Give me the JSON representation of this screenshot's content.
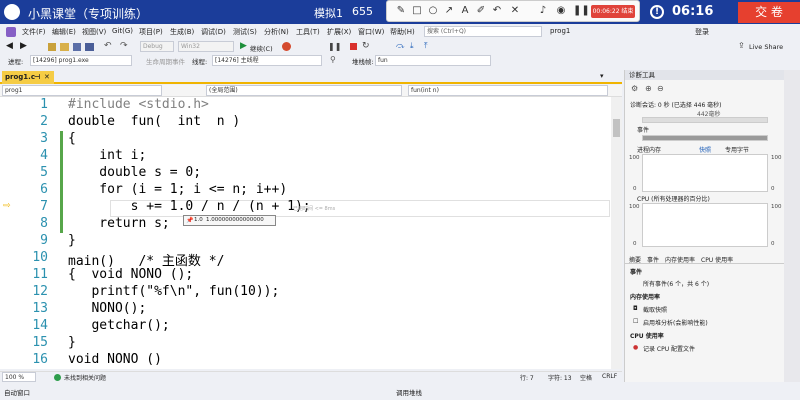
{
  "exam": {
    "title": "小黑课堂（专项训练）",
    "subtitle": "模拟1",
    "subtitle_suffix": "655",
    "record_time": "00:06:22 结束",
    "timer": "06:16",
    "submit": "交 卷"
  },
  "menu": [
    "文件(F)",
    "编辑(E)",
    "视图(V)",
    "Git(G)",
    "项目(P)",
    "生成(B)",
    "调试(D)",
    "测试(S)",
    "分析(N)",
    "工具(T)",
    "扩展(X)",
    "窗口(W)",
    "帮助(H)"
  ],
  "search_placeholder": "搜索 (Ctrl+Q)",
  "solution_name": "prog1",
  "login": "登录",
  "live_share": "Live Share",
  "toolbar": {
    "config": "Debug",
    "platform": "Win32",
    "continue": "继续(C)"
  },
  "procbar": {
    "process_label": "进程:",
    "process": "[14296] prog1.exe",
    "lifecycle": "生命周期事件",
    "thread_label": "线程:",
    "thread": "[14276] 主线程",
    "stack_label": "堆栈帧:",
    "stack": "fun"
  },
  "doc_tab": "prog1.c",
  "nav": {
    "project": "prog1",
    "scope": "(全局范围)",
    "function": "fun(int n)"
  },
  "code_lines": [
    {
      "n": "1",
      "text": "#include <stdio.h>"
    },
    {
      "n": "2",
      "text": "double  fun(  int  n )"
    },
    {
      "n": "3",
      "text": "{"
    },
    {
      "n": "4",
      "text": "    int i;"
    },
    {
      "n": "5",
      "text": "    double s = 0;"
    },
    {
      "n": "6",
      "text": "    for (i = 1; i <= n; i++)"
    },
    {
      "n": "7",
      "text": "        s += 1.0 / n / (n + 1);"
    },
    {
      "n": "8",
      "text": "    return s;"
    },
    {
      "n": "9",
      "text": "}"
    },
    {
      "n": "10",
      "text": "main()   /* 主函数 */"
    },
    {
      "n": "11",
      "text": "{  void NONO ();"
    },
    {
      "n": "12",
      "text": "   printf(\"%f\\n\", fun(10));"
    },
    {
      "n": "13",
      "text": "   NONO();"
    },
    {
      "n": "14",
      "text": "   getchar();"
    },
    {
      "n": "15",
      "text": "}"
    },
    {
      "n": "16",
      "text": "void NONO ()"
    }
  ],
  "codelens": "已用时间 <= 8ms",
  "datatip": {
    "expr": "1.0",
    "value": "1.000000000000000"
  },
  "editor_status": {
    "zoom": "100 %",
    "issues": "未找到相关问题",
    "line": "行: 7",
    "char": "字符: 13",
    "mode": "空格",
    "eol": "CRLF"
  },
  "bottom": {
    "left": "自动窗口",
    "right": "调用堆栈"
  },
  "diag": {
    "title": "诊断工具",
    "session": "诊断会话: 0 秒 (已选择 446 毫秒)",
    "tick": "442毫秒",
    "events": "事件",
    "memory": "进程内存",
    "snapshot": "快照",
    "private_bytes": "专用字节",
    "mem_top": "100",
    "mem_bottom": "0",
    "cpu": "CPU (所有处理器的百分比)",
    "cpu_top": "100",
    "cpu_bottom": "0",
    "tabs": [
      "摘要",
      "事件",
      "内存使用率",
      "CPU 使用率"
    ],
    "sec_events": "事件",
    "all_events": "所有事件(6 个，共 6 个)",
    "sec_memory": "内存使用率",
    "take_snapshot": "截取快照",
    "heap": "启用堆分析(会影响性能)",
    "sec_cpu": "CPU 使用率",
    "record_cpu": "记录 CPU 配置文件"
  },
  "colors": {
    "exam_bar": "#1b3d9a",
    "submit": "#e6402f",
    "tab": "#f5cc45"
  }
}
